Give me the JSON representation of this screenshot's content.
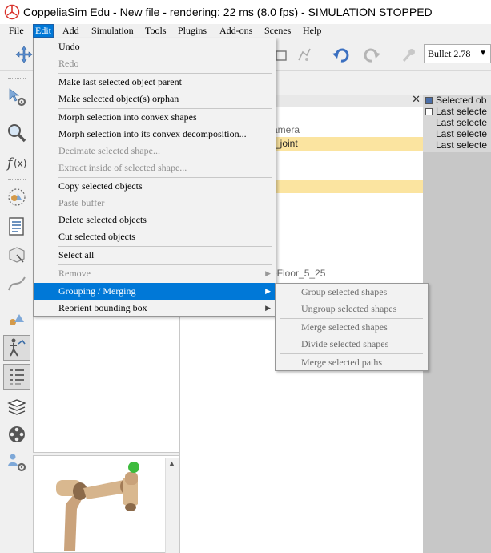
{
  "window": {
    "title": "CoppeliaSim Edu - New file - rendering: 22 ms (8.0 fps) - SIMULATION STOPPED"
  },
  "menubar": {
    "items": [
      "File",
      "Edit",
      "Add",
      "Simulation",
      "Tools",
      "Plugins",
      "Add-ons",
      "Scenes",
      "Help"
    ],
    "active": "Edit"
  },
  "toolbar": {
    "physics_engine": "Bullet 2.78"
  },
  "edit_menu": {
    "items": [
      {
        "label": "Undo",
        "enabled": true
      },
      {
        "label": "Redo",
        "enabled": false
      },
      {
        "label": "Make last selected object parent",
        "enabled": true
      },
      {
        "label": "Make selected object(s) orphan",
        "enabled": true
      },
      {
        "label": "Morph selection into convex shapes",
        "enabled": true
      },
      {
        "label": "Morph selection into its convex decomposition...",
        "enabled": true
      },
      {
        "label": "Decimate selected shape...",
        "enabled": false
      },
      {
        "label": "Extract inside of selected shape...",
        "enabled": false
      },
      {
        "label": "Copy selected objects",
        "enabled": true
      },
      {
        "label": "Paste buffer",
        "enabled": false
      },
      {
        "label": "Delete selected objects",
        "enabled": true
      },
      {
        "label": "Cut selected objects",
        "enabled": true
      },
      {
        "label": "Select all",
        "enabled": true
      },
      {
        "label": "Remove",
        "enabled": false,
        "submenu": true
      },
      {
        "label": "Grouping / Merging",
        "enabled": true,
        "submenu": true,
        "highlighted": true
      },
      {
        "label": "Reorient bounding box",
        "enabled": true,
        "submenu": true
      }
    ]
  },
  "grouping_submenu": {
    "items": [
      {
        "label": "Group selected shapes",
        "enabled": false
      },
      {
        "label": "Ungroup selected shapes",
        "enabled": false
      },
      {
        "label": "Merge selected shapes",
        "enabled": false
      },
      {
        "label": "Divide selected shapes",
        "enabled": false
      },
      {
        "label": "Merge selected paths",
        "enabled": false
      }
    ]
  },
  "scene_hierarchy": {
    "visible_rows": [
      {
        "text": "amera",
        "selected": false
      },
      {
        "text": "_joint",
        "selected": true
      },
      {
        "text": "",
        "selected": true
      },
      {
        "text": "eFloor_5_25",
        "selected": false
      }
    ]
  },
  "info_text": {
    "lines": [
      "Selected ob",
      "Last selecte",
      "Last selecte",
      "Last selecte",
      "Last selecte"
    ]
  },
  "colors": {
    "menu_highlight": "#0078d7",
    "selected_row": "#fbe4a0",
    "scene_background": "#c7c7c7"
  }
}
